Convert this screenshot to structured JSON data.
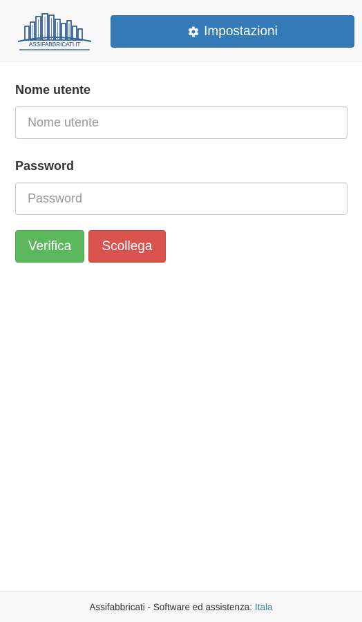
{
  "header": {
    "logo_text": "ASSIFABBRICATI.IT",
    "settings_label": "Impostazioni",
    "settings_icon": "gear-icon"
  },
  "form": {
    "username": {
      "label": "Nome utente",
      "placeholder": "Nome utente",
      "value": ""
    },
    "password": {
      "label": "Password",
      "placeholder": "Password",
      "value": ""
    },
    "verify_label": "Verifica",
    "disconnect_label": "Scollega"
  },
  "footer": {
    "text": "Assifabbricati - Software ed assistenza:",
    "link_text": "Itala"
  },
  "colors": {
    "primary": "#337ab7",
    "success": "#5cb85c",
    "danger": "#d9534f",
    "header_bg": "#f8f8f8",
    "logo_blue": "#1f4e8c"
  }
}
